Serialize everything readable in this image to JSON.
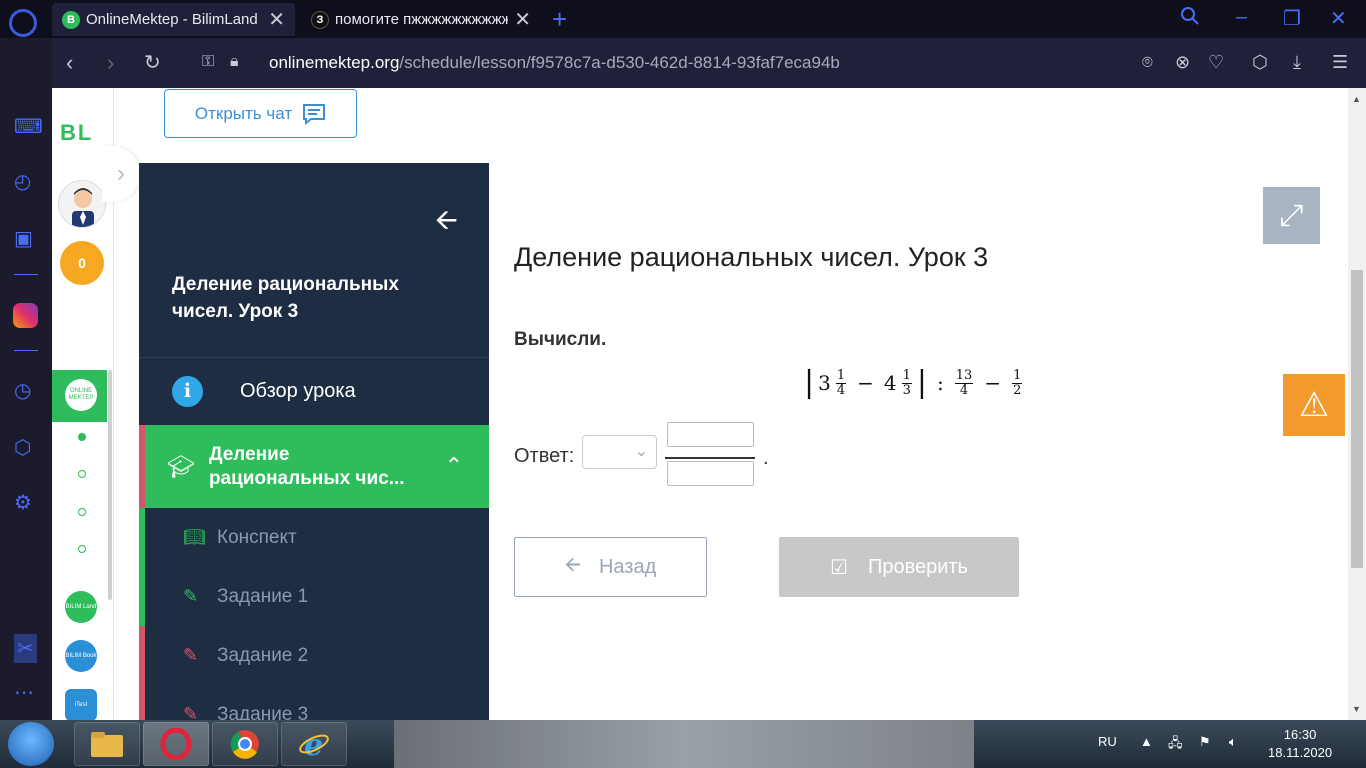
{
  "browser": {
    "tabs": [
      {
        "favicon": "B",
        "title": "OnlineMektep - BilimLand",
        "favicon_color": "#2fbd5c"
      },
      {
        "favicon": "З",
        "title": "помогите пжжжжжжжжжжжжж",
        "favicon_color": "#111111"
      }
    ],
    "url_domain": "onlinemektep.org",
    "url_path": "/schedule/lesson/f9578c7a-d530-462d-8814-93faf7eca94b"
  },
  "rail": {
    "logo": "BL",
    "coins": "0",
    "online_badge": "ONLINE MEKTEP",
    "app1": "BILIM Land",
    "app2": "BILIM Book",
    "app3": "iTest"
  },
  "chat_button": "Открыть чат",
  "lesson": {
    "title": "Деление рациональных чисел. Урок 3",
    "overview": "Обзор урока",
    "section": "Деление рациональных чис...",
    "items": [
      "Конспект",
      "Задание 1",
      "Задание 2",
      "Задание 3"
    ]
  },
  "task": {
    "title": "Деление рациональных чисел. Урок 3",
    "prompt": "Вычисли.",
    "formula": {
      "w1": "3",
      "n1": "1",
      "d1": "4",
      "minus": "−",
      "w2": "4",
      "n2": "1",
      "d2": "3",
      "div": ":",
      "n3": "13",
      "d3": "4",
      "n4": "1",
      "d4": "2"
    },
    "answer_label": "Ответ:",
    "period": "."
  },
  "buttons": {
    "back": "Назад",
    "check": "Проверить"
  },
  "taskbar": {
    "lang": "RU",
    "time": "16:30",
    "date": "18.11.2020"
  },
  "colors": {
    "accent_green": "#2fbd5c",
    "panel": "#1f2d43",
    "accent_red": "#d2576a",
    "warn": "#f39a2e"
  }
}
